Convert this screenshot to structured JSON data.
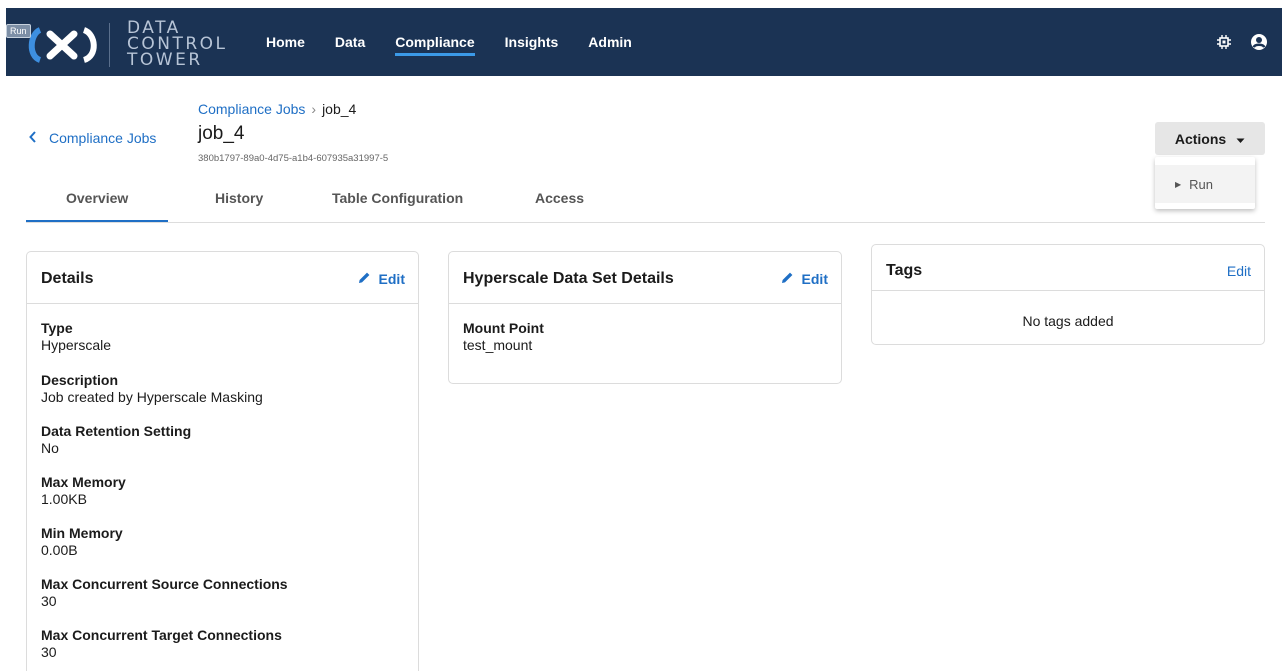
{
  "app": {
    "tooltip": "Run",
    "logo_lines": [
      "DATA",
      "CONTROL",
      "TOWER"
    ],
    "nav": [
      {
        "label": "Home",
        "active": false
      },
      {
        "label": "Data",
        "active": false
      },
      {
        "label": "Compliance",
        "active": true
      },
      {
        "label": "Insights",
        "active": false
      },
      {
        "label": "Admin",
        "active": false
      }
    ],
    "icons": [
      "chip-icon",
      "user-icon"
    ]
  },
  "header": {
    "back_label": "Compliance Jobs",
    "breadcrumb": {
      "parent": "Compliance Jobs",
      "separator": "›",
      "current": "job_4"
    },
    "title": "job_4",
    "id": "380b1797-89a0-4d75-a1b4-607935a31997-5",
    "actions_label": "Actions",
    "actions_menu": [
      {
        "label": "Run"
      }
    ]
  },
  "tabs": [
    {
      "label": "Overview",
      "active": true
    },
    {
      "label": "History",
      "active": false
    },
    {
      "label": "Table Configuration",
      "active": false
    },
    {
      "label": "Access",
      "active": false
    }
  ],
  "details": {
    "title": "Details",
    "edit_label": "Edit",
    "fields": [
      {
        "label": "Type",
        "value": "Hyperscale"
      },
      {
        "label": "Description",
        "value": "Job created by Hyperscale Masking"
      },
      {
        "label": "Data Retention Setting",
        "value": "No"
      },
      {
        "label": "Max Memory",
        "value": "1.00KB"
      },
      {
        "label": "Min Memory",
        "value": "0.00B"
      },
      {
        "label": "Max Concurrent Source Connections",
        "value": "30"
      },
      {
        "label": "Max Concurrent Target Connections",
        "value": "30"
      }
    ]
  },
  "hyperscale": {
    "title": "Hyperscale Data Set Details",
    "edit_label": "Edit",
    "fields": [
      {
        "label": "Mount Point",
        "value": "test_mount"
      }
    ]
  },
  "tags": {
    "title": "Tags",
    "edit_label": "Edit",
    "empty_text": "No tags added"
  },
  "colors": {
    "nav_bg": "#1b3354",
    "link": "#1f6fc5",
    "active_underline": "#3b9ae8"
  }
}
